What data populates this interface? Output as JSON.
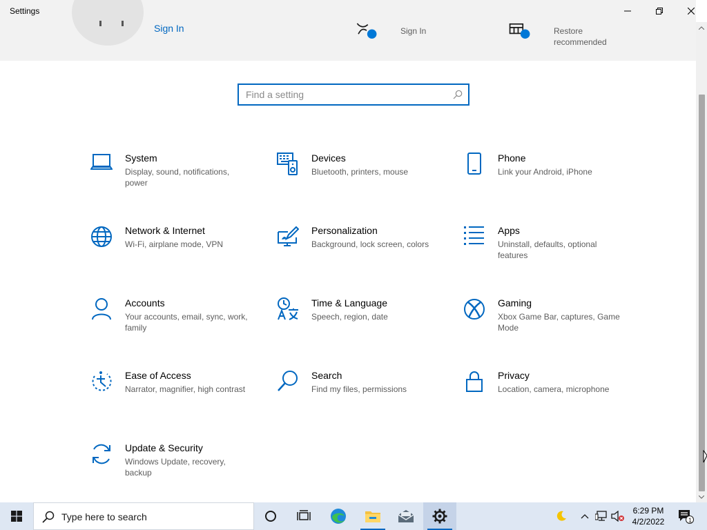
{
  "window": {
    "title": "Settings"
  },
  "header": {
    "sign_in_link": "Sign In",
    "cloud_sign_in": "Sign In",
    "restore_line1": "Restore",
    "restore_line2": "recommended",
    "badge_color": "#0078d7"
  },
  "search": {
    "placeholder": "Find a setting",
    "value": ""
  },
  "categories": [
    {
      "name": "System",
      "desc": "Display, sound, notifications, power",
      "icon": "laptop-icon"
    },
    {
      "name": "Devices",
      "desc": "Bluetooth, printers, mouse",
      "icon": "devices-icon"
    },
    {
      "name": "Phone",
      "desc": "Link your Android, iPhone",
      "icon": "phone-icon"
    },
    {
      "name": "Network & Internet",
      "desc": "Wi-Fi, airplane mode, VPN",
      "icon": "globe-icon"
    },
    {
      "name": "Personalization",
      "desc": "Background, lock screen, colors",
      "icon": "paint-icon"
    },
    {
      "name": "Apps",
      "desc": "Uninstall, defaults, optional features",
      "icon": "apps-list-icon"
    },
    {
      "name": "Accounts",
      "desc": "Your accounts, email, sync, work, family",
      "icon": "person-icon"
    },
    {
      "name": "Time & Language",
      "desc": "Speech, region, date",
      "icon": "time-language-icon"
    },
    {
      "name": "Gaming",
      "desc": "Xbox Game Bar, captures, Game Mode",
      "icon": "xbox-icon"
    },
    {
      "name": "Ease of Access",
      "desc": "Narrator, magnifier, high contrast",
      "icon": "ease-of-access-icon"
    },
    {
      "name": "Search",
      "desc": "Find my files, permissions",
      "icon": "search-icon"
    },
    {
      "name": "Privacy",
      "desc": "Location, camera, microphone",
      "icon": "lock-icon"
    },
    {
      "name": "Update & Security",
      "desc": "Windows Update, recovery, backup",
      "icon": "sync-icon"
    }
  ],
  "taskbar": {
    "search_text": "Type here to search",
    "time": "6:29 PM",
    "date": "4/2/2022",
    "notification_count": "1"
  },
  "colors": {
    "accent": "#0067c0",
    "icon_blue": "#0067c0",
    "header_bg": "#f2f2f2",
    "taskbar_bg": "#dee7f3"
  }
}
